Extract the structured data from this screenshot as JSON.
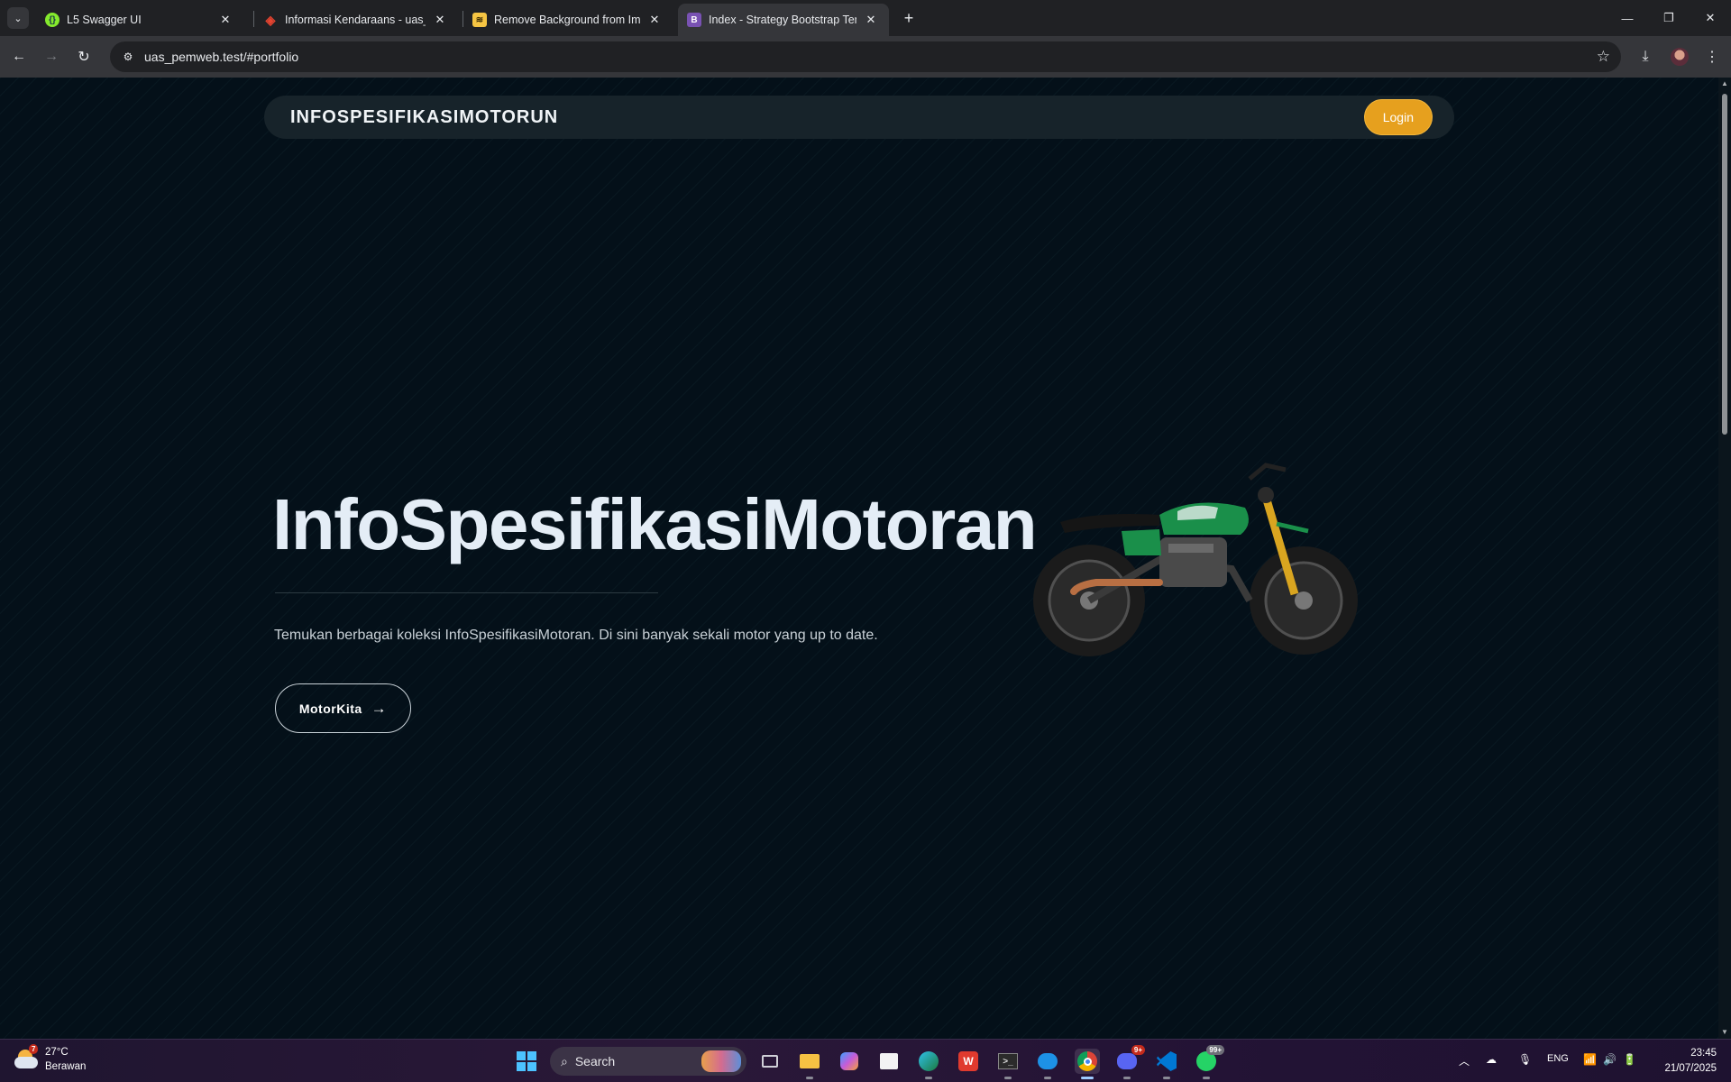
{
  "browser": {
    "tabs": [
      {
        "title": "L5 Swagger UI",
        "favicon_color": "#85ea2d"
      },
      {
        "title": "Informasi Kendaraans - uas_pemweb",
        "favicon_color": "#e74430"
      },
      {
        "title": "Remove Background from Image",
        "favicon_color": "#f6c543"
      },
      {
        "title": "Index - Strategy Bootstrap Template",
        "favicon_color": "#7952b3",
        "favicon_letter": "B",
        "active": true
      }
    ],
    "url": "uas_pemweb.test/#portfolio"
  },
  "page": {
    "brand": "INFOSPESIFIKASIMOTORUN",
    "login_label": "Login",
    "hero_title": "InfoSpesifikasiMotoran",
    "hero_description": "Temukan berbagai koleksi InfoSpesifikasiMotoran. Di sini banyak sekali motor yang up to date.",
    "cta_label": "MotorKita",
    "accent_color": "#e6a01e"
  },
  "taskbar": {
    "weather_temp": "27°C",
    "weather_desc": "Berawan",
    "weather_badge": "7",
    "search_placeholder": "Search",
    "discord_badge": "9+",
    "whatsapp_badge": "99+",
    "language": "ENG",
    "time": "23:45",
    "date": "21/07/2025"
  }
}
